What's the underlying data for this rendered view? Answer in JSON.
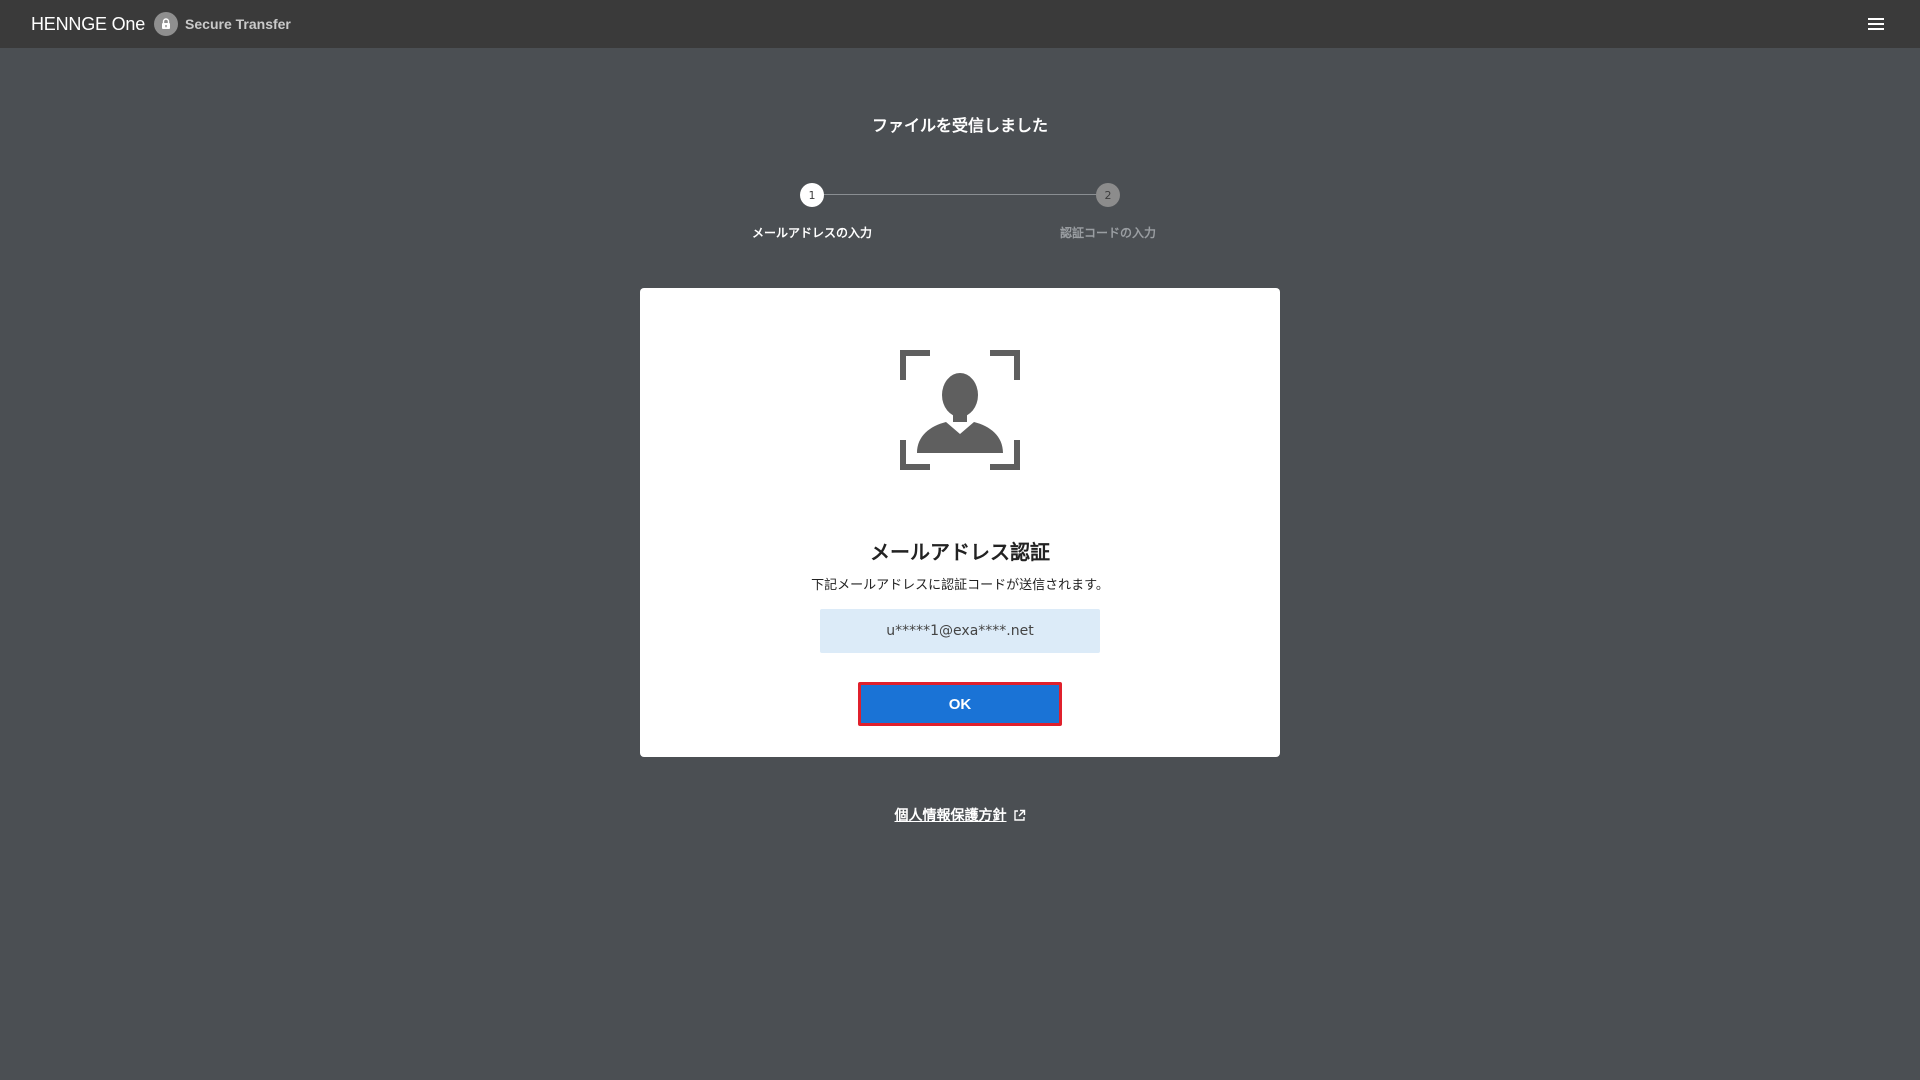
{
  "header": {
    "logo_text": "HENNGE One",
    "product_name": "Secure Transfer",
    "menu_icon": "hamburger-menu-icon"
  },
  "page": {
    "title": "ファイルを受信しました"
  },
  "stepper": {
    "steps": [
      {
        "number": "1",
        "label": "メールアドレスの入力",
        "state": "active"
      },
      {
        "number": "2",
        "label": "認証コードの入力",
        "state": "inactive"
      }
    ]
  },
  "card": {
    "icon": "user-scan-icon",
    "heading": "メールアドレス認証",
    "description": "下記メールアドレスに認証コードが送信されます。",
    "email": "u*****1@exa****.net",
    "ok_label": "OK"
  },
  "footer": {
    "privacy_link": "個人情報保護方針",
    "external_icon": "external-link-icon"
  },
  "colors": {
    "background": "#4b4f53",
    "header": "#3a3a3a",
    "primary_button": "#1a73d6",
    "highlight_border": "#e0202c",
    "email_box": "#dcebf8"
  }
}
